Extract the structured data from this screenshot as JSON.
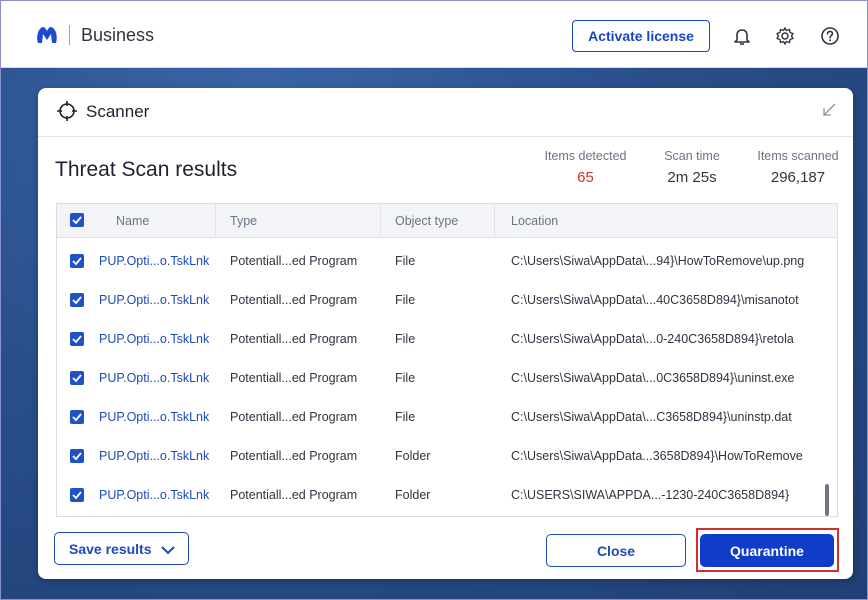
{
  "header": {
    "brand": "Business",
    "activate_label": "Activate license",
    "icons": [
      "bell-icon",
      "gear-icon",
      "help-icon"
    ]
  },
  "panel": {
    "title": "Scanner",
    "results_title": "Threat Scan results",
    "stats": {
      "items_detected_label": "Items detected",
      "items_detected_value": "65",
      "scan_time_label": "Scan time",
      "scan_time_value": "2m 25s",
      "items_scanned_label": "Items scanned",
      "items_scanned_value": "296,187"
    },
    "table": {
      "headers": {
        "name": "Name",
        "type": "Type",
        "object_type": "Object type",
        "location": "Location"
      },
      "rows": [
        {
          "name": "PUP.Opti...o.TskLnk",
          "type": "Potentiall...ed Program",
          "object_type": "File",
          "location": "C:\\Users\\Siwa\\AppData\\...94}\\HowToRemove\\up.png"
        },
        {
          "name": "PUP.Opti...o.TskLnk",
          "type": "Potentiall...ed Program",
          "object_type": "File",
          "location": "C:\\Users\\Siwa\\AppData\\...40C3658D894}\\misanotot"
        },
        {
          "name": "PUP.Opti...o.TskLnk",
          "type": "Potentiall...ed Program",
          "object_type": "File",
          "location": "C:\\Users\\Siwa\\AppData\\...0-240C3658D894}\\retola"
        },
        {
          "name": "PUP.Opti...o.TskLnk",
          "type": "Potentiall...ed Program",
          "object_type": "File",
          "location": "C:\\Users\\Siwa\\AppData\\...0C3658D894}\\uninst.exe"
        },
        {
          "name": "PUP.Opti...o.TskLnk",
          "type": "Potentiall...ed Program",
          "object_type": "File",
          "location": "C:\\Users\\Siwa\\AppData\\...C3658D894}\\uninstp.dat"
        },
        {
          "name": "PUP.Opti...o.TskLnk",
          "type": "Potentiall...ed Program",
          "object_type": "Folder",
          "location": "C:\\Users\\Siwa\\AppData...3658D894}\\HowToRemove"
        },
        {
          "name": "PUP.Opti...o.TskLnk",
          "type": "Potentiall...ed Program",
          "object_type": "Folder",
          "location": "C:\\USERS\\SIWA\\APPDA...-1230-240C3658D894}"
        }
      ]
    },
    "buttons": {
      "save": "Save results",
      "close": "Close",
      "quarantine": "Quarantine"
    }
  },
  "colors": {
    "accent": "#1947c4",
    "danger": "#d0312d",
    "primary_button": "#0f3cc9"
  }
}
